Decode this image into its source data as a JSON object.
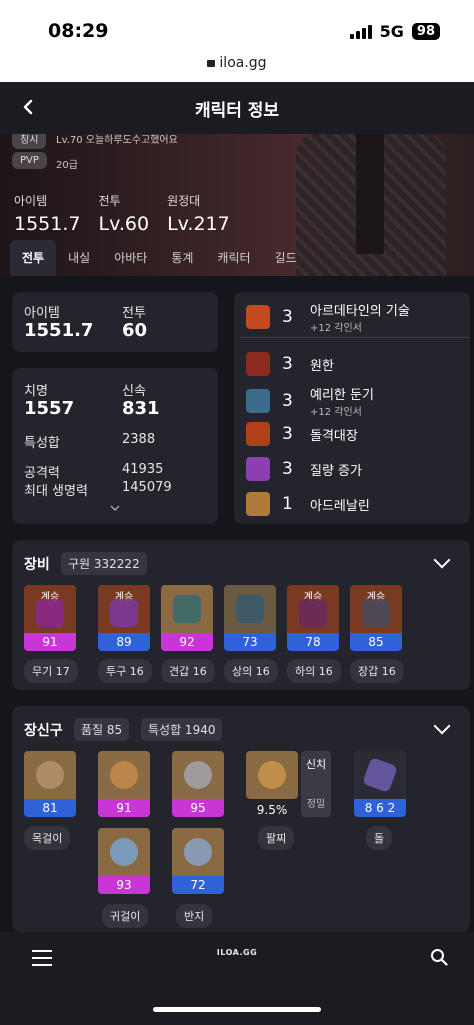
{
  "status": {
    "time": "08:29",
    "network": "5G",
    "battery": "98",
    "url": "iloa.gg"
  },
  "header": {
    "title": "캐릭터 정보"
  },
  "hero": {
    "tag1": "칭시",
    "tag1_text": "Lv.70 오늘하루도수고했어요",
    "tag2": "PVP",
    "tag2_text": "20급",
    "stats": [
      {
        "label": "아이템",
        "value": "1551.7"
      },
      {
        "label": "전투",
        "value": "Lv.60"
      },
      {
        "label": "원정대",
        "value": "Lv.217"
      }
    ]
  },
  "tabs": [
    "전투",
    "내실",
    "아바타",
    "통계",
    "캐릭터",
    "길드"
  ],
  "summary": {
    "item_label": "아이템",
    "item_value": "1551.7",
    "combat_label": "전투",
    "combat_value": "60"
  },
  "combat_stats": {
    "crit_label": "치명",
    "crit_value": "1557",
    "swift_label": "신속",
    "swift_value": "831",
    "total_label": "특성합",
    "total_value": "2388",
    "atk_label": "공격력",
    "atk_value": "41935",
    "hp_label": "최대 생명력",
    "hp_value": "145079"
  },
  "engravings": [
    {
      "level": "3",
      "name": "아르데타인의 기술",
      "sub": "+12 각인서",
      "color": "#c24a1f"
    },
    {
      "level": "3",
      "name": "원한",
      "sub": "",
      "color": "#8c2a1e"
    },
    {
      "level": "3",
      "name": "예리한 둔기",
      "sub": "+12 각인서",
      "color": "#3b6c8c"
    },
    {
      "level": "3",
      "name": "돌격대장",
      "sub": "",
      "color": "#b0401c"
    },
    {
      "level": "3",
      "name": "질량 증가",
      "sub": "",
      "color": "#8c3fb0"
    },
    {
      "level": "1",
      "name": "아드레날린",
      "sub": "",
      "color": "#b07a3a"
    }
  ],
  "equipment": {
    "title": "장비",
    "pill": "구원 332222",
    "items": [
      {
        "badge": "계승",
        "quality": "91",
        "qcolor": "pink",
        "label": "무기 17",
        "bg": "#7a3a22",
        "shape": "#8a2a8a"
      },
      {
        "badge": "계승",
        "quality": "89",
        "qcolor": "blue",
        "label": "투구 16",
        "bg": "#7a3a22",
        "shape": "#7a3a9a"
      },
      {
        "badge": "",
        "quality": "92",
        "qcolor": "pink",
        "label": "견갑 16",
        "bg": "#8a6a42",
        "shape": "#3a6a6a"
      },
      {
        "badge": "",
        "quality": "73",
        "qcolor": "blue",
        "label": "상의 16",
        "bg": "#6a5a42",
        "shape": "#3a5a6a"
      },
      {
        "badge": "계승",
        "quality": "78",
        "qcolor": "blue",
        "label": "하의 16",
        "bg": "#7a3a22",
        "shape": "#6a2a5a"
      },
      {
        "badge": "계승",
        "quality": "85",
        "qcolor": "blue",
        "label": "장갑 16",
        "bg": "#7a3a22",
        "shape": "#4a4a5a"
      }
    ]
  },
  "accessories": {
    "title": "장신구",
    "pill1": "품질 85",
    "pill2": "특성합 1940",
    "items": [
      {
        "quality": "81",
        "qcolor": "blue",
        "bg": "#8a6a42",
        "shape": "#b0906a"
      },
      {
        "quality": "91",
        "qcolor": "pink",
        "bg": "#8a6a42",
        "shape": "#c08a4a"
      },
      {
        "quality": "95",
        "qcolor": "pink",
        "bg": "#8a6a42",
        "shape": "#a0a0a8"
      },
      {
        "quality": "93",
        "qcolor": "pink",
        "bg": "#8a6a42",
        "shape": "#7aa0c8"
      },
      {
        "quality": "72",
        "qcolor": "blue",
        "bg": "#8a6a42",
        "shape": "#8aa0c0"
      }
    ],
    "labels": [
      "목걸이",
      "귀걸이",
      "반지"
    ],
    "bracelet": {
      "percent": "9.5%",
      "tag1": "신치",
      "tag2": "정밀",
      "label": "팔찌"
    },
    "stone": {
      "value": "8 6 2",
      "label": "돌"
    }
  },
  "bottom": {
    "brand": "ILOA.GG"
  }
}
